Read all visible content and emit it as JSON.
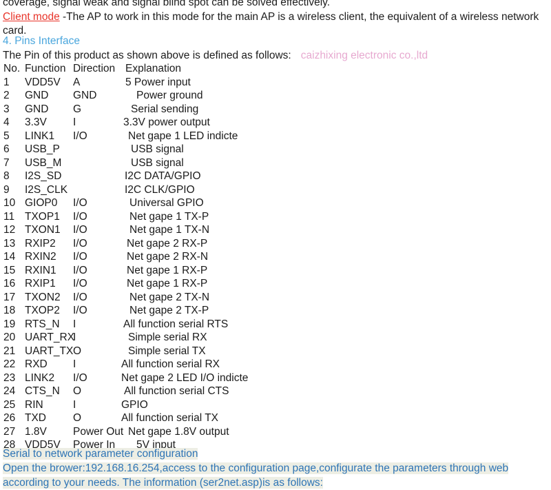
{
  "document": {
    "intro": {
      "line_top": "coverage, signal weak and signal blind spot can be solved effectively.",
      "client_mode_label": "Client mode",
      "client_mode_text": " -The AP to work in this mode for the main AP is a wireless client, the equivalent of a wireless network card."
    },
    "section_heading": "4. Pins Interface",
    "lead_line": "The Pin of this product as shown above is defined as follows:",
    "watermark": "caizhixing electronic co.,ltd",
    "table": {
      "headers": {
        "no": "No.",
        "function": "Function",
        "direction": "Direction",
        "explanation": "Explanation"
      },
      "rows": [
        {
          "no": "1",
          "function": "VDD5V",
          "direction": "A",
          "explanation": "5 Power input",
          "indent": 0
        },
        {
          "no": "2",
          "function": "GND",
          "direction": "GND",
          "explanation": "Power ground",
          "indent": 16
        },
        {
          "no": "3",
          "function": "GND",
          "direction": "G",
          "explanation": "Serial sending",
          "indent": 8
        },
        {
          "no": "4",
          "function": "3.3V",
          "direction": "I",
          "explanation": "3.3V power output",
          "indent": -3
        },
        {
          "no": "5",
          "function": "LINK1",
          "direction": "I/O",
          "explanation": "Net gape 1 LED indicte",
          "indent": 4
        },
        {
          "no": "6",
          "function": "USB_P",
          "direction": "",
          "explanation": "USB signal",
          "indent": 8
        },
        {
          "no": "7",
          "function": "USB_M",
          "direction": "",
          "explanation": "USB signal",
          "indent": 8
        },
        {
          "no": "8",
          "function": "I2S_SD",
          "direction": "",
          "explanation": "I2C DATA/GPIO",
          "indent": -1
        },
        {
          "no": "9",
          "function": "I2S_CLK",
          "direction": "",
          "explanation": "I2C CLK/GPIO",
          "indent": -1
        },
        {
          "no": "10",
          "function": "GIOP0",
          "direction": "I/O",
          "explanation": "Universal GPIO",
          "indent": 6
        },
        {
          "no": "11",
          "function": "TXOP1",
          "direction": "I/O",
          "explanation": "Net gape 1 TX-P",
          "indent": 6
        },
        {
          "no": "12",
          "function": "TXON1",
          "direction": "I/O",
          "explanation": "Net gape 1 TX-N",
          "indent": 6
        },
        {
          "no": "13",
          "function": "RXIP2",
          "direction": "I/O",
          "explanation": "Net gape 2 RX-P",
          "indent": 2
        },
        {
          "no": "14",
          "function": "RXIN2",
          "direction": "I/O",
          "explanation": "Net gape 2 RX-N",
          "indent": 2
        },
        {
          "no": "15",
          "function": "RXIN1",
          "direction": "I/O",
          "explanation": "Net gape 1 RX-P",
          "indent": 2
        },
        {
          "no": "16",
          "function": "RXIP1",
          "direction": "I/O",
          "explanation": "Net gape 1 RX-P",
          "indent": 2
        },
        {
          "no": "17",
          "function": "TXON2",
          "direction": "I/O",
          "explanation": "Net gape 2 TX-N",
          "indent": 6
        },
        {
          "no": "18",
          "function": "TXOP2",
          "direction": "I/O",
          "explanation": "Net gape 2 TX-P",
          "indent": 6
        },
        {
          "no": "19",
          "function": "RTS_N",
          "direction": "I",
          "explanation": "All function serial RTS",
          "indent": -3
        },
        {
          "no": "20",
          "function": "UART_RX",
          "direction": "I",
          "explanation": "Simple serial RX",
          "indent": 4
        },
        {
          "no": "21",
          "function": "UART_TX",
          "direction": "O",
          "explanation": "Simple serial TX",
          "indent": 4
        },
        {
          "no": "22",
          "function": "RXD",
          "direction": "I",
          "explanation": "All function serial RX",
          "indent": -6
        },
        {
          "no": "23",
          "function": "LINK2",
          "direction": "I/O",
          "explanation": "Net gape 2 LED I/O indicte",
          "indent": -6
        },
        {
          "no": "24",
          "function": "CTS_N",
          "direction": "O",
          "explanation": "All function serial CTS",
          "indent": -2
        },
        {
          "no": "25",
          "function": "RIN",
          "direction": "I",
          "explanation": "GPIO",
          "indent": -6
        },
        {
          "no": "26",
          "function": "TXD",
          "direction": "O",
          "explanation": "All function serial TX",
          "indent": -6
        },
        {
          "no": "27",
          "function": "1.8V",
          "direction": "Power Out",
          "explanation": "Net gape 1.8V output",
          "indent": 4
        },
        {
          "no": "28",
          "function": "VDD5V",
          "direction": "Power In",
          "explanation": "5V input",
          "indent": 16
        }
      ]
    },
    "footer": {
      "line1": "Serial to network parameter configuration",
      "line2": "Open the brower:192.168.16.254,access to the configuration page,configurate the parameters through web according to your needs. The information (ser2net.asp)is as follows:"
    }
  },
  "colors": {
    "link_red": "#e8342a",
    "heading_blue": "#49a6dd",
    "footer_blue": "#2e74b5",
    "watermark_pink": "#e7a9d0",
    "highlight": "#edeee4",
    "text": "#1c1c1c"
  }
}
